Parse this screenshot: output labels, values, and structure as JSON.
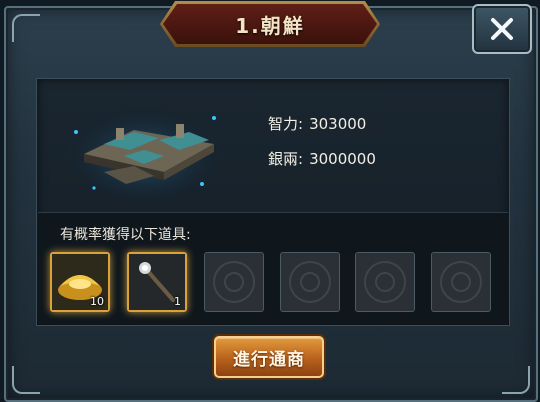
{
  "title": "1.朝鮮",
  "close_icon": "close-icon",
  "stats": [
    {
      "label": "智力:",
      "value": "303000"
    },
    {
      "label": "銀兩:",
      "value": "3000000"
    }
  ],
  "rewards": {
    "title": "有概率獲得以下道具:",
    "slots": [
      {
        "item": "gold-ingot-icon",
        "qty": "10"
      },
      {
        "item": "staff-icon",
        "qty": "1"
      },
      {
        "item": "empty"
      },
      {
        "item": "empty"
      },
      {
        "item": "empty"
      },
      {
        "item": "empty"
      }
    ]
  },
  "action_button": "進行通商",
  "colors": {
    "title_plate": "#4a160f",
    "accent_gold": "#d9a23b",
    "button_orange": "#c26a22"
  }
}
